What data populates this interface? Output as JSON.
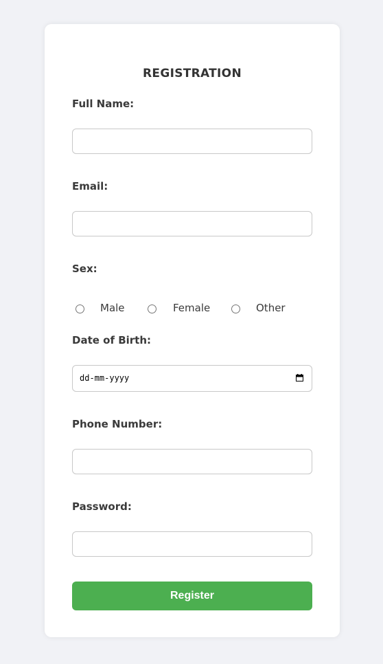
{
  "form": {
    "title": "REGISTRATION",
    "full_name": {
      "label": "Full Name:",
      "value": ""
    },
    "email": {
      "label": "Email:",
      "value": ""
    },
    "sex": {
      "label": "Sex:",
      "options": [
        "Male",
        "Female",
        "Other"
      ]
    },
    "dob": {
      "label": "Date of Birth:",
      "value": "dd-mm-yyyy"
    },
    "phone": {
      "label": "Phone Number:",
      "value": ""
    },
    "password": {
      "label": "Password:",
      "value": ""
    },
    "submit_label": "Register"
  },
  "colors": {
    "background": "#f1f2f6",
    "card": "#ffffff",
    "button": "#4caf50",
    "button_text": "#ffffff",
    "field_border": "#c8c8c8"
  },
  "icons": {
    "date_picker": "calendar-icon"
  }
}
